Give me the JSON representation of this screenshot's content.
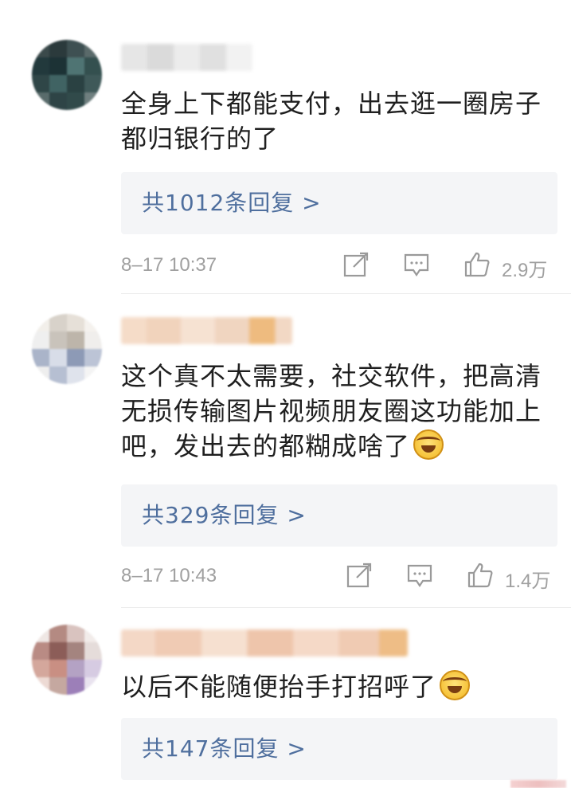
{
  "comments": [
    {
      "text": "全身上下都能支付，出去逛一圈房子都归银行的了",
      "replies": "共1012条回复 >",
      "time": "8–17 10:37",
      "likes": "2.9万",
      "has_emoji": false
    },
    {
      "text": "这个真不太需要，社交软件，把高清无损传输图片视频朋友圈这功能加上吧，发出去的都糊成啥了",
      "replies": "共329条回复 >",
      "time": "8–17 10:43",
      "likes": "1.4万",
      "has_emoji": true
    },
    {
      "text": "以后不能随便抬手打招呼了",
      "replies": "共147条回复 >",
      "has_emoji": true
    }
  ],
  "icons": {
    "share": "share-icon",
    "comment": "comment-icon",
    "like": "thumbs-up-icon",
    "emoji": "laughing-crying-emoji-icon"
  },
  "colors": {
    "reply_link": "#4f6f9e",
    "meta_gray": "#a0a0a0",
    "reply_bg": "#f4f5f7"
  }
}
